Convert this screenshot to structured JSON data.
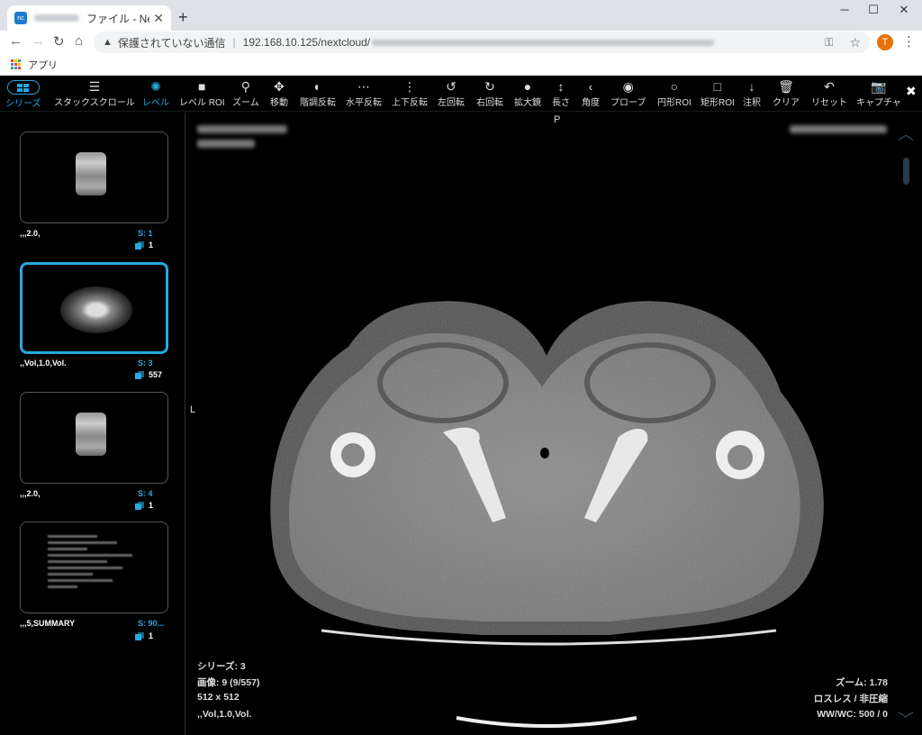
{
  "browser": {
    "tab_title": "ファイル - Nextcloud",
    "favicon_text": "nc",
    "url_warning": "保護されていない通信",
    "url_host": "192.168.10.125/nextcloud/",
    "avatar_letter": "T",
    "bookmarks_apps": "アプリ"
  },
  "toolbar": {
    "items": [
      {
        "label": "シリーズ",
        "icon": "grid-icon"
      },
      {
        "label": "スタックスクロール",
        "icon": "menu-icon"
      },
      {
        "label": "レベル",
        "icon": "sun-icon"
      },
      {
        "label": "レベル ROI",
        "icon": "square-icon"
      },
      {
        "label": "ズーム",
        "icon": "search-icon"
      },
      {
        "label": "移動",
        "icon": "move-icon"
      },
      {
        "label": "階調反転",
        "icon": "contrast-icon"
      },
      {
        "label": "水平反転",
        "icon": "dots-icon"
      },
      {
        "label": "上下反転",
        "icon": "vertical-dots-icon"
      },
      {
        "label": "左回転",
        "icon": "rotate-left-icon"
      },
      {
        "label": "右回転",
        "icon": "rotate-right-icon"
      },
      {
        "label": "拡大鏡",
        "icon": "circle-icon"
      },
      {
        "label": "長さ",
        "icon": "length-icon"
      },
      {
        "label": "角度",
        "icon": "angle-icon"
      },
      {
        "label": "プローブ",
        "icon": "probe-icon"
      },
      {
        "label": "円形ROI",
        "icon": "circle-outline-icon"
      },
      {
        "label": "矩形ROI",
        "icon": "square-outline-icon"
      },
      {
        "label": "注釈",
        "icon": "arrow-down-icon"
      },
      {
        "label": "クリア",
        "icon": "trash-icon"
      },
      {
        "label": "リセット",
        "icon": "undo-icon"
      },
      {
        "label": "キャプチャ",
        "icon": "camera-icon"
      }
    ],
    "accent_color": "#27a8e0"
  },
  "series": [
    {
      "caption": ",,,2.0,",
      "s_label": "S: 1",
      "count": "1"
    },
    {
      "caption": ",,Vol,1.0,Vol.",
      "s_label": "S: 3",
      "count": "557"
    },
    {
      "caption": ",,,2.0,",
      "s_label": "S: 4",
      "count": "1"
    },
    {
      "caption": ",,,5,SUMMARY",
      "s_label": "S: 90...",
      "count": "1"
    }
  ],
  "viewport": {
    "orient_top": "P",
    "orient_left": "L",
    "series_line": "シリーズ: 3",
    "image_line": "画像: 9 (9/557)",
    "size_line": "512 x 512",
    "desc_line": ",,Vol,1.0,Vol.",
    "zoom_line": "ズーム: 1.78",
    "compression_line": "ロスレス / 非圧縮",
    "wwwc_line": "WW/WC: 500 / 0"
  }
}
